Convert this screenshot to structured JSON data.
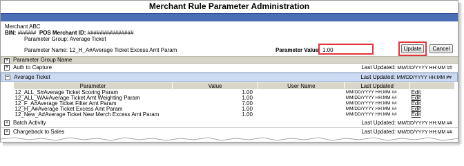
{
  "title": "Merchant Rule Parameter Administration",
  "merchant": {
    "name": "Merchant ABC",
    "bin_label": "BIN:",
    "bin_value": "######",
    "pos_label": "POS Merchant ID:",
    "pos_value": "###############"
  },
  "parameter_group": {
    "label": "Parameter Group:",
    "value": "Average Ticket"
  },
  "parameter_name": {
    "label": "Parameter Name:",
    "value": "12_H_A#Average Ticket Excess Amt Param"
  },
  "parameter_value": {
    "label": "Parameter Value:",
    "value": "1.00"
  },
  "buttons": {
    "update": "Update",
    "cancel": "Cancel"
  },
  "groups_header": "Parameter Group Name",
  "groups": [
    {
      "name": "Auth to Capture",
      "last_updated_label": "Last Updated:",
      "last_updated": "MM/DD/YYYY HH:MM ##",
      "expanded": false
    },
    {
      "name": "Average Ticket",
      "last_updated_label": "Last Updated:",
      "last_updated": "MM/DD/YYYY HH:MM ##",
      "expanded": true
    },
    {
      "name": "Batch Activity",
      "last_updated_label": "Last Updated:",
      "last_updated": "MM/DD/YYYY HH:MM ##",
      "expanded": false
    },
    {
      "name": "Chargeback to Sales",
      "last_updated_label": "Last Updated:",
      "last_updated": "MM/DD/YYYY HH:MM ##",
      "expanded": false
    }
  ],
  "table": {
    "columns": [
      "Parameter",
      "Value",
      "User Name",
      "Last Updated"
    ],
    "rows": [
      {
        "parameter": "12_ALL_S#Average Ticket Scoring Param",
        "value": "1.00",
        "user": "",
        "updated": "MM/DD/YYYY HH:MM ##",
        "action": "Edit"
      },
      {
        "parameter": "12_ALL_WA#Average Ticket Amt Weighting Param",
        "value": "1.00",
        "user": "",
        "updated": "MM/DD/YYYY HH:MM ##",
        "action": "Edit"
      },
      {
        "parameter": "12_F_A#Average Ticket Filter Amt Param",
        "value": "7.00",
        "user": "",
        "updated": "MM/DD/YYYY HH:MM ##",
        "action": "Edit"
      },
      {
        "parameter": "12_H_A#Average Ticket Excess Amt Param",
        "value": "1.00",
        "user": "",
        "updated": "MM/DD/YYYY HH:MM ##",
        "action": "Edit"
      },
      {
        "parameter": "12_New_A#Average Ticket New Merch Excess Amt Param",
        "value": "1.00",
        "user": "",
        "updated": "MM/DD/YYYY HH:MM ##",
        "action": "Edit"
      }
    ]
  },
  "toggle_icons": {
    "collapsed": "+",
    "expanded": "−"
  }
}
